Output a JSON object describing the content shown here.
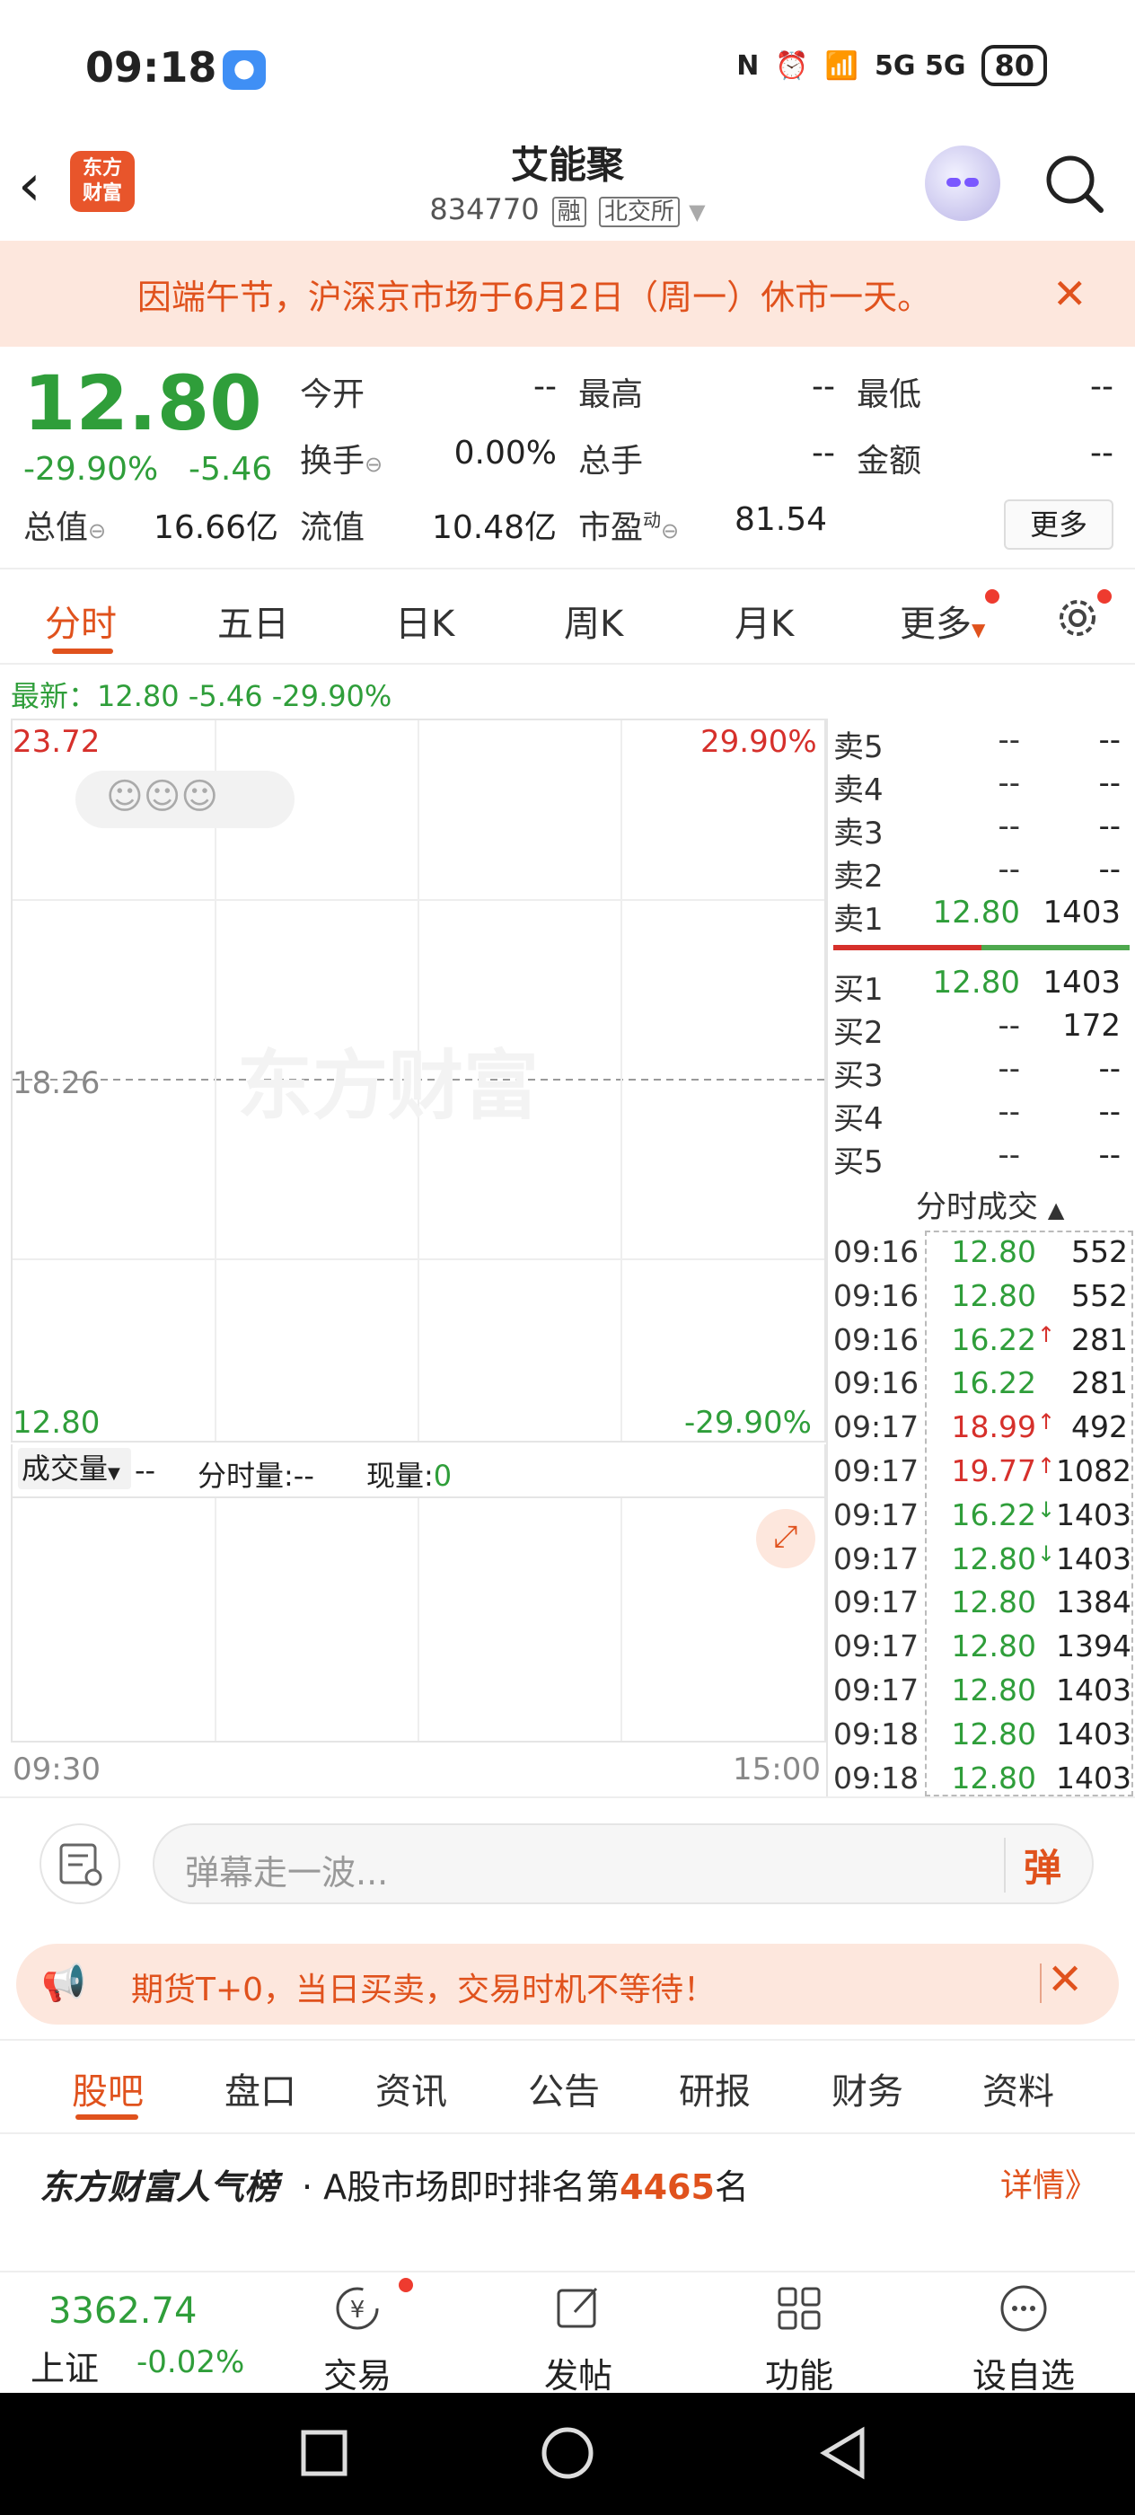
{
  "status_bar": {
    "time": "09:18",
    "signal": "5G 5G",
    "battery": "80"
  },
  "header": {
    "stock_name": "艾能聚",
    "stock_code": "834770",
    "tag_margin": "融",
    "tag_exchange": "北交所",
    "logo_text_1": "东方",
    "logo_text_2": "财富"
  },
  "notice": {
    "text": "因端午节，沪深京市场于6月2日（周一）休市一天。"
  },
  "quote": {
    "price": "12.80",
    "pct": "-29.90%",
    "chg": "-5.46",
    "open_label": "今开",
    "open_val": "--",
    "high_label": "最高",
    "high_val": "--",
    "low_label": "最低",
    "low_val": "--",
    "turnover_label": "换手",
    "turnover_val": "0.00%",
    "volume_label": "总手",
    "volume_val": "--",
    "amount_label": "金额",
    "amount_val": "--",
    "mcap_label": "总值",
    "mcap_val": "16.66亿",
    "float_label": "流值",
    "float_val": "10.48亿",
    "pe_label": "市盈",
    "pe_sup": "动",
    "pe_val": "81.54",
    "more_button": "更多"
  },
  "tabs": [
    "分时",
    "五日",
    "日K",
    "周K",
    "月K",
    "更多"
  ],
  "latest": "最新：12.80  -5.46  -29.90%",
  "chart": {
    "top_left": "23.72",
    "top_right": "29.90%",
    "mid": "18.26",
    "bottom_left": "12.80",
    "bottom_right": "-29.90%",
    "watermark": "东方财富",
    "vol_label": "成交量",
    "vol_dash": "--",
    "minute_vol": "分时量:--",
    "now_vol_label": "现量:",
    "now_vol_val": "0",
    "time_start": "09:30",
    "time_end": "15:00"
  },
  "order_book": {
    "asks": [
      {
        "label": "卖5",
        "price": "--",
        "vol": "--"
      },
      {
        "label": "卖4",
        "price": "--",
        "vol": "--"
      },
      {
        "label": "卖3",
        "price": "--",
        "vol": "--"
      },
      {
        "label": "卖2",
        "price": "--",
        "vol": "--"
      },
      {
        "label": "卖1",
        "price": "12.80",
        "vol": "1403"
      }
    ],
    "bids": [
      {
        "label": "买1",
        "price": "12.80",
        "vol": "1403"
      },
      {
        "label": "买2",
        "price": "--",
        "vol": "172"
      },
      {
        "label": "买3",
        "price": "--",
        "vol": "--"
      },
      {
        "label": "买4",
        "price": "--",
        "vol": "--"
      },
      {
        "label": "买5",
        "price": "--",
        "vol": "--"
      }
    ]
  },
  "trades_title": "分时成交",
  "trades": [
    {
      "t": "09:16",
      "p": "12.80",
      "a": "",
      "v": "552"
    },
    {
      "t": "09:16",
      "p": "12.80",
      "a": "",
      "v": "552"
    },
    {
      "t": "09:16",
      "p": "16.22",
      "a": "↑",
      "v": "281"
    },
    {
      "t": "09:16",
      "p": "16.22",
      "a": "",
      "v": "281"
    },
    {
      "t": "09:17",
      "p": "18.99",
      "a": "↑",
      "v": "492"
    },
    {
      "t": "09:17",
      "p": "19.77",
      "a": "↑",
      "v": "1082"
    },
    {
      "t": "09:17",
      "p": "16.22",
      "a": "↓",
      "v": "1403"
    },
    {
      "t": "09:17",
      "p": "12.80",
      "a": "↓",
      "v": "1403"
    },
    {
      "t": "09:17",
      "p": "12.80",
      "a": "",
      "v": "1384"
    },
    {
      "t": "09:17",
      "p": "12.80",
      "a": "",
      "v": "1394"
    },
    {
      "t": "09:17",
      "p": "12.80",
      "a": "",
      "v": "1403"
    },
    {
      "t": "09:18",
      "p": "12.80",
      "a": "",
      "v": "1403"
    },
    {
      "t": "09:18",
      "p": "12.80",
      "a": "",
      "v": "1403"
    }
  ],
  "comment": {
    "placeholder": "弹幕走一波...",
    "button": "弹"
  },
  "ad": {
    "text": "期货T+0，当日买卖，交易时机不等待！"
  },
  "bottom_tabs": [
    "股吧",
    "盘口",
    "资讯",
    "公告",
    "研报",
    "财务",
    "资料"
  ],
  "rank": {
    "title": "东方财富人气榜",
    "text_pre": "· A股市场即时排名第",
    "num": "4465",
    "text_post": "名",
    "detail": "详情》"
  },
  "index": {
    "value": "3362.74",
    "name": "上证",
    "pct": "-0.02%"
  },
  "nav": [
    "交易",
    "发帖",
    "功能",
    "设自选"
  ],
  "colors": {
    "down": "#2f9e3a",
    "up": "#d6302b",
    "accent": "#e0521d"
  }
}
